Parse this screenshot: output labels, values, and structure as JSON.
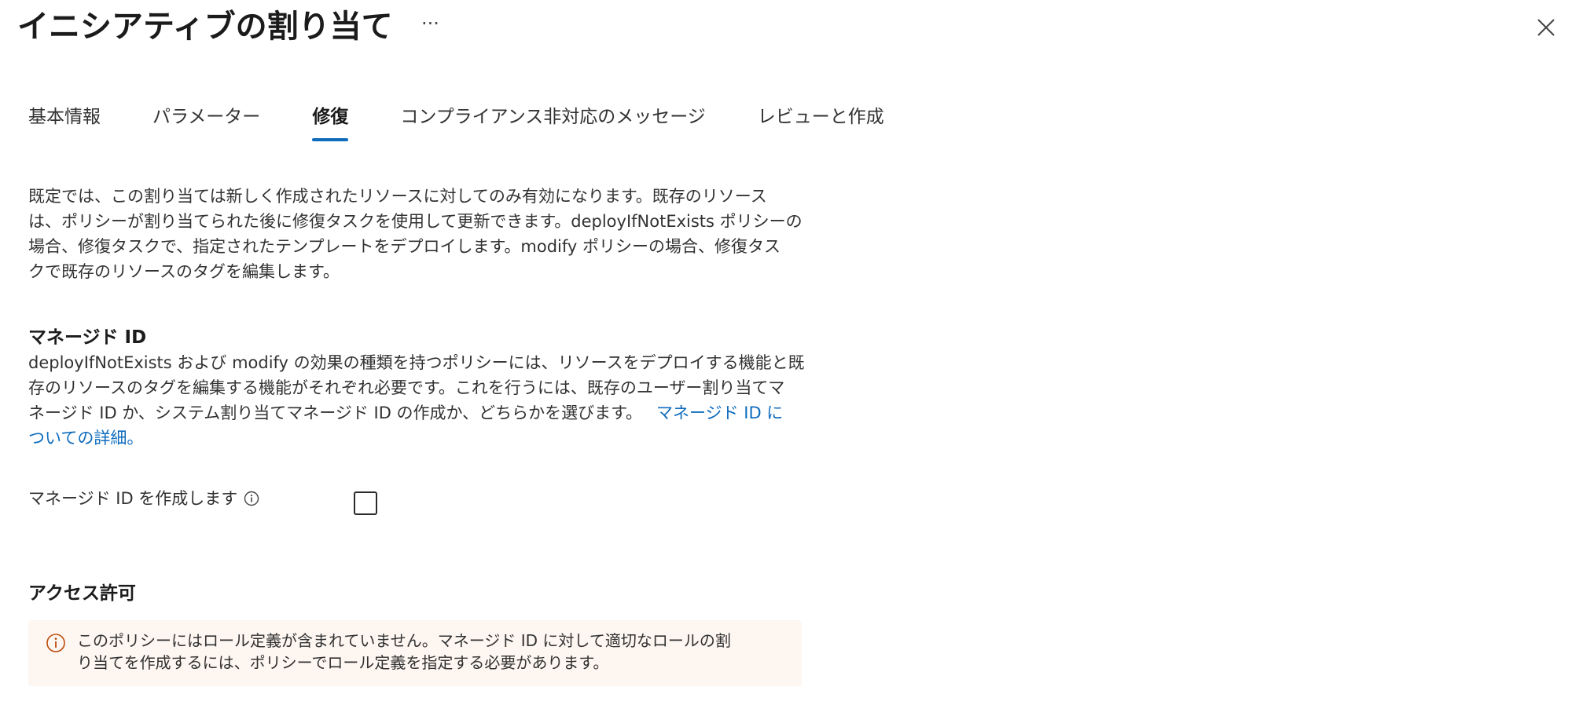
{
  "header": {
    "title": "イニシアティブの割り当て",
    "more_label": "···"
  },
  "icons": {
    "close": "close-icon",
    "more": "more-horizontal-icon",
    "info": "info-icon",
    "warning": "warning-circle-icon"
  },
  "tabs": [
    {
      "label": "基本情報",
      "active": false
    },
    {
      "label": "パラメーター",
      "active": false
    },
    {
      "label": "修復",
      "active": true
    },
    {
      "label": "コンプライアンス非対応のメッセージ",
      "active": false
    },
    {
      "label": "レビューと作成",
      "active": false
    }
  ],
  "intro": {
    "line1": "既定では、この割り当ては新しく作成されたリソースに対してのみ有効になります。既存のリソース",
    "line2": "は、ポリシーが割り当てられた後に修復タスクを使用して更新できます。deployIfNotExists ポリシーの",
    "line3": "場合、修復タスクで、指定されたテンプレートをデプロイします。modify ポリシーの場合、修復タス",
    "line4": "クで既存のリソースのタグを編集します。"
  },
  "managed_identity": {
    "heading": "マネージド ID",
    "line1": "deployIfNotExists および modify の効果の種類を持つポリシーには、リソースをデプロイする機能と既",
    "line2": "存のリソースのタグを編集する機能がそれぞれ必要です。これを行うには、既存のユーザー割り当てマ",
    "line3": "ネージド ID か、システム割り当てマネージド ID の作成か、どちらかを選びます。",
    "link_part1": "マネージド ID に",
    "link_part2": "ついての詳細。",
    "create_label": "マネージド ID を作成します",
    "create_checked": false
  },
  "access": {
    "heading": "アクセス許可",
    "banner_line1": "このポリシーにはロール定義が含まれていません。マネージド ID に対して適切なロールの割",
    "banner_line2": "り当てを作成するには、ポリシーでロール定義を指定する必要があります。"
  },
  "colors": {
    "accent": "#0f6cbd",
    "warning": "#bc4b09",
    "banner_bg": "#fdf6f1"
  }
}
